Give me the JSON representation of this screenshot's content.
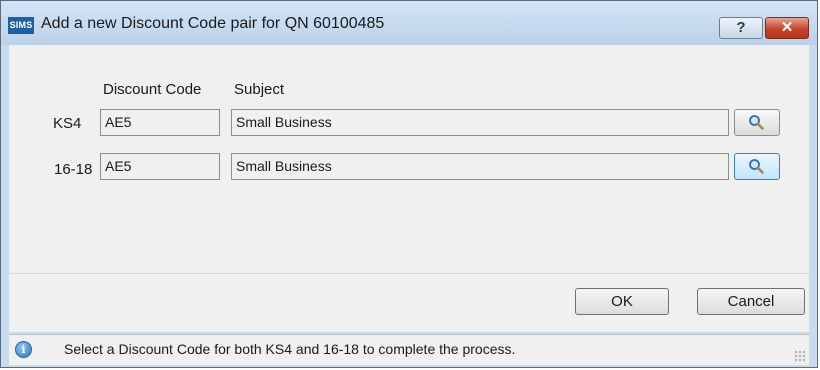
{
  "window": {
    "app_icon_text": "SIMS",
    "title": "Add a new Discount Code pair for QN 60100485",
    "help_label": "?",
    "close_label": "✕"
  },
  "columns": {
    "discount_code": "Discount Code",
    "subject": "Subject"
  },
  "rows": [
    {
      "label": "KS4",
      "discount_code": "AE5",
      "subject": "Small Business",
      "search_icon": "magnifier-icon"
    },
    {
      "label": "16-18",
      "discount_code": "AE5",
      "subject": "Small Business",
      "search_icon": "magnifier-icon"
    }
  ],
  "buttons": {
    "ok": "OK",
    "cancel": "Cancel"
  },
  "status": {
    "icon": "info-icon",
    "message": "Select a Discount Code for both KS4 and 16-18 to complete the process."
  },
  "colors": {
    "title_bar": "#c9dbee",
    "close_button": "#c8432c",
    "app_icon": "#1f5fa8"
  }
}
